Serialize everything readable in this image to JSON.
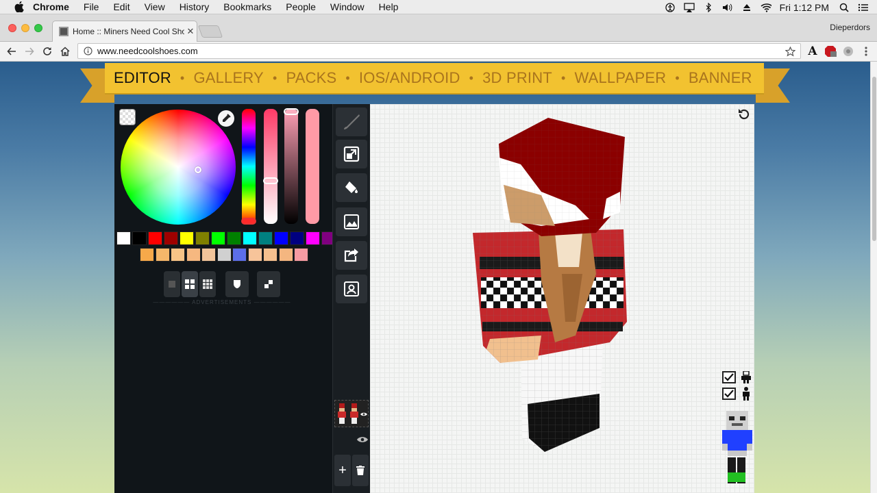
{
  "menubar": {
    "items": [
      "Chrome",
      "File",
      "Edit",
      "View",
      "History",
      "Bookmarks",
      "People",
      "Window",
      "Help"
    ],
    "clock": "Fri 1:12 PM"
  },
  "browser": {
    "tab_title": "Home :: Miners Need Cool Sho",
    "profile": "Dieperdors",
    "url": "www.needcoolshoes.com"
  },
  "site": {
    "nav": [
      "EDITOR",
      "GALLERY",
      "PACKS",
      "IOS/ANDROID",
      "3D PRINT",
      "WALLPAPER",
      "BANNER"
    ],
    "active_nav": "EDITOR",
    "ads_label": "ADVERTISEMENTS"
  },
  "editor": {
    "palette_row1": [
      "#ffffff",
      "#000000",
      "#ff0000",
      "#9e0000",
      "#ffff00",
      "#808000",
      "#00ff00",
      "#008000",
      "#00ffff",
      "#008080",
      "#0000ff",
      "#000080",
      "#ff00ff",
      "#800080"
    ],
    "palette_row2": [
      "#f7a94a",
      "#f5b76a",
      "#f8c487",
      "#f6b880",
      "#f2c49a",
      "#d0d0d0",
      "#5c6ee8",
      "#f7c49a",
      "#f5c08e",
      "#f4b680",
      "#f79ba3"
    ],
    "current_color": "#ff9aa6",
    "tools": [
      "brush-icon",
      "select-icon",
      "fill-icon",
      "effects-icon",
      "export-icon",
      "skin-icon"
    ],
    "viewport_toggles": [
      {
        "label": "overlay",
        "checked": true
      },
      {
        "label": "body",
        "checked": true
      }
    ]
  }
}
